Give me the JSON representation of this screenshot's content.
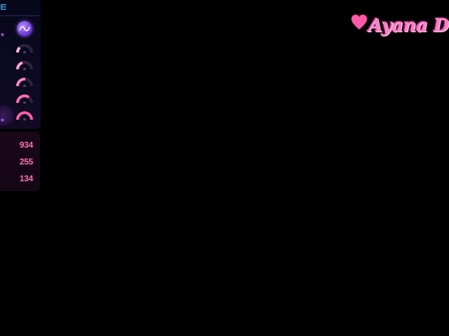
{
  "overlay": {
    "header_icon": "menu-icon",
    "avatar_icon": "avatar-icon",
    "levels": [
      {
        "level": 1,
        "icon": "gauge-icon"
      },
      {
        "level": 2,
        "icon": "gauge-icon"
      },
      {
        "level": 3,
        "icon": "gauge-icon"
      },
      {
        "level": 4,
        "icon": "gauge-icon"
      },
      {
        "level": 5,
        "icon": "gauge-icon"
      }
    ],
    "stats": [
      "934",
      "255",
      "134"
    ]
  },
  "logo": {
    "text": "Ayana D",
    "icon": "heart-icon"
  },
  "colors": {
    "background": "#000000",
    "accent_pink": "#ff6fb0",
    "accent_blue": "#3aa8ff",
    "avatar_purple": "#6b3ed6"
  }
}
